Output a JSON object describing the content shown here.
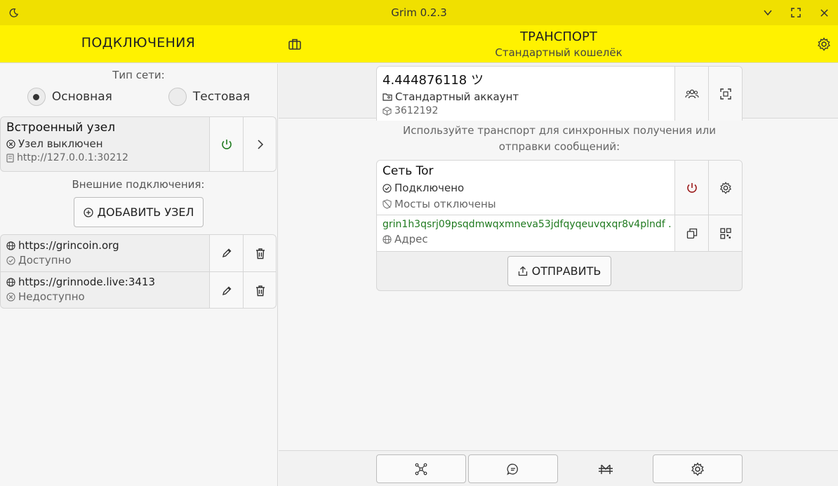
{
  "window": {
    "title": "Grim 0.2.3"
  },
  "header": {
    "left_title": "ПОДКЛЮЧЕНИЯ",
    "center_title": "ТРАНСПОРТ",
    "center_subtitle": "Стандартный кошелёк"
  },
  "left": {
    "network_type_label": "Тип сети:",
    "network_options": [
      {
        "label": "Основная",
        "selected": true
      },
      {
        "label": "Тестовая",
        "selected": false
      }
    ],
    "integrated_node": {
      "name": "Встроенный узел",
      "status": "Узел выключен",
      "address": "http://127.0.0.1:30212"
    },
    "external_label": "Внешние подключения:",
    "add_node_label": "ДОБАВИТЬ УЗЕЛ",
    "external_nodes": [
      {
        "url": "https://grincoin.org",
        "status": "Доступно"
      },
      {
        "url": "https://grinnode.live:3413",
        "status": "Недоступно"
      }
    ]
  },
  "wallet": {
    "balance": "4.444876118 ツ",
    "account": "Стандартный аккаунт",
    "height": "3612192"
  },
  "transport": {
    "description_line1": "Используйте транспорт для синхронных получения или",
    "description_line2": "отправки сообщений:",
    "tor_title": "Сеть Tor",
    "tor_status": "Подключено",
    "bridges_status": "Мосты отключены",
    "address": "grin1h3qsrj09psqdmwqxmneva53jdfqyqeuvqxqr8v4plndf ...",
    "address_label": "Адрес",
    "send_label": "ОТПРАВИТЬ"
  },
  "colors": {
    "titlebar": "#f0e000",
    "header": "#fff200",
    "power_on": "#1f7a1f",
    "power_off": "#9b1b1b",
    "address": "#1f7a1f"
  }
}
